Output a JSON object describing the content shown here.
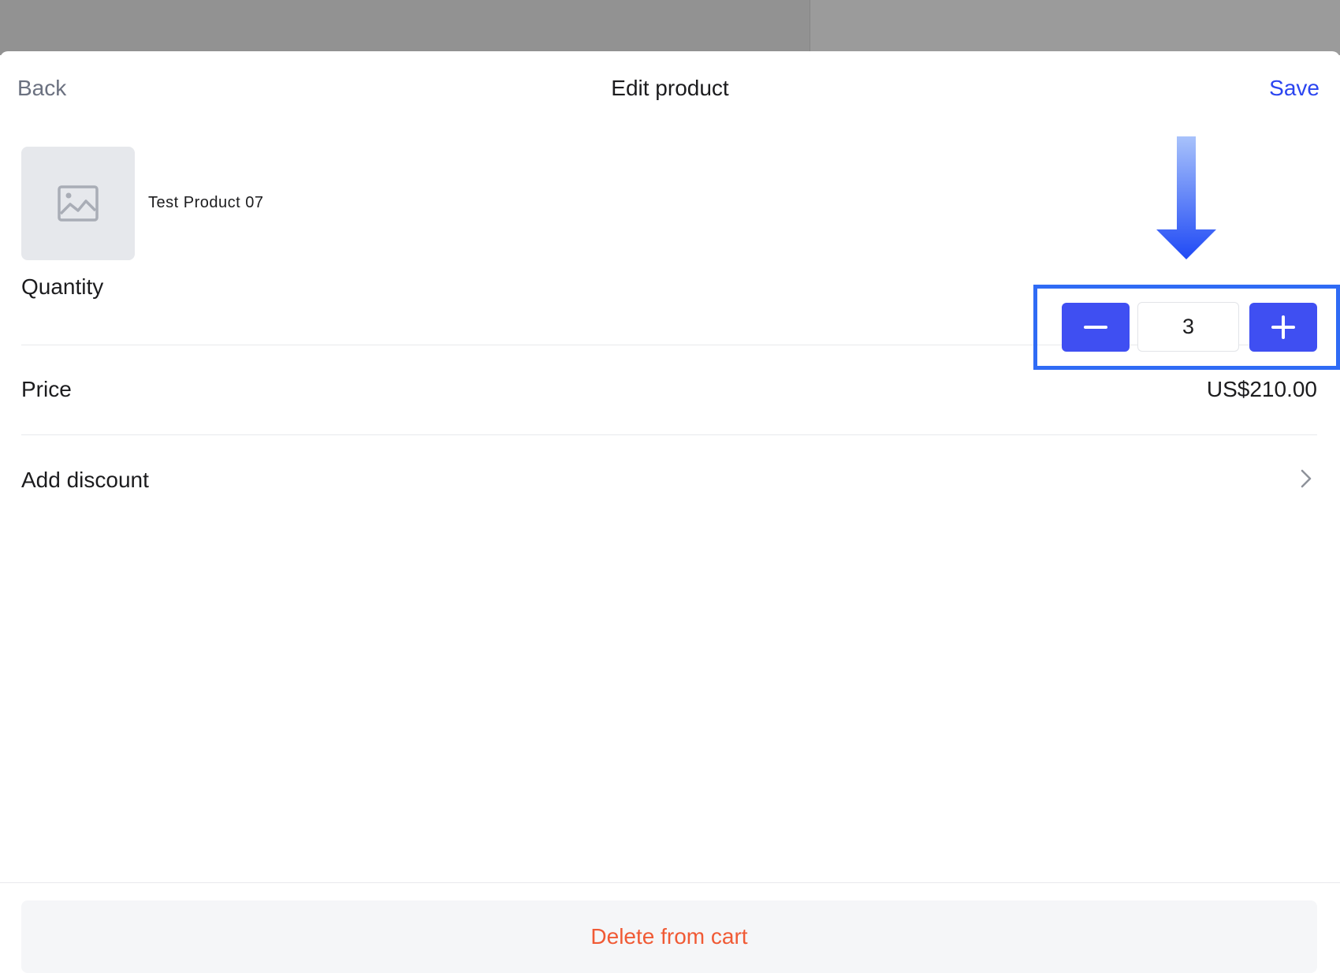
{
  "nav": {
    "back_label": "Back",
    "title": "Edit product",
    "save_label": "Save"
  },
  "product": {
    "name": "Test Product 07",
    "image_icon": "image-placeholder-icon"
  },
  "quantity": {
    "label": "Quantity",
    "value": "3",
    "decrement_icon": "minus-icon",
    "increment_icon": "plus-icon"
  },
  "price": {
    "label": "Price",
    "value": "US$210.00"
  },
  "discount": {
    "label": "Add discount",
    "icon": "chevron-right-icon"
  },
  "footer": {
    "delete_label": "Delete from cart"
  },
  "colors": {
    "accent": "#3f4ff2",
    "save_link": "#2b45f0",
    "destructive": "#f05a35",
    "highlight_box": "#2f6bf5"
  }
}
